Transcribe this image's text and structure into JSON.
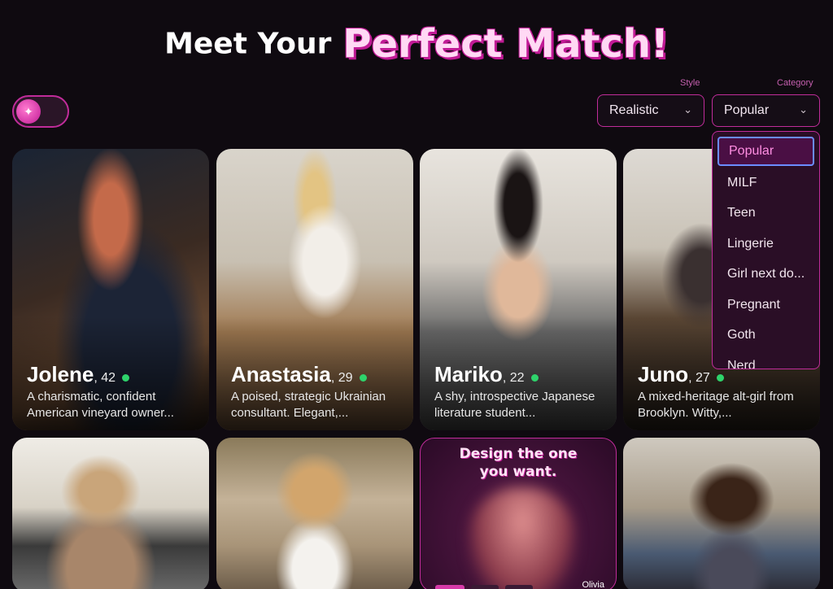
{
  "header": {
    "title_part1": "Meet Your",
    "title_part2": "Perfect Match!"
  },
  "filters": {
    "style_label": "Style",
    "style_value": "Realistic",
    "category_label": "Category",
    "category_value": "Popular",
    "category_options": [
      "Popular",
      "MILF",
      "Teen",
      "Lingerie",
      "Girl next do...",
      "Pregnant",
      "Goth",
      "Nerd"
    ]
  },
  "cards": [
    {
      "name": "Jolene",
      "age": ", 42",
      "desc": "A charismatic, confident American vineyard owner..."
    },
    {
      "name": "Anastasia",
      "age": ", 29",
      "desc": "A poised, strategic Ukrainian consultant. Elegant,..."
    },
    {
      "name": "Mariko",
      "age": ", 22",
      "desc": "A shy, introspective Japanese literature student..."
    },
    {
      "name": "Juno",
      "age": ", 27",
      "desc": "A mixed-heritage alt-girl from Brooklyn. Witty,..."
    }
  ],
  "promo": {
    "text_line1": "Design the one",
    "text_line2": "you want.",
    "name": "Olivia"
  },
  "colors": {
    "accent": "#c02c9a",
    "background": "#0f0a10",
    "online": "#2ed36b",
    "highlight": "#6b8cff"
  },
  "icons": {
    "toggle": "sparkle-icon",
    "dropdown": "chevron-down-icon"
  }
}
